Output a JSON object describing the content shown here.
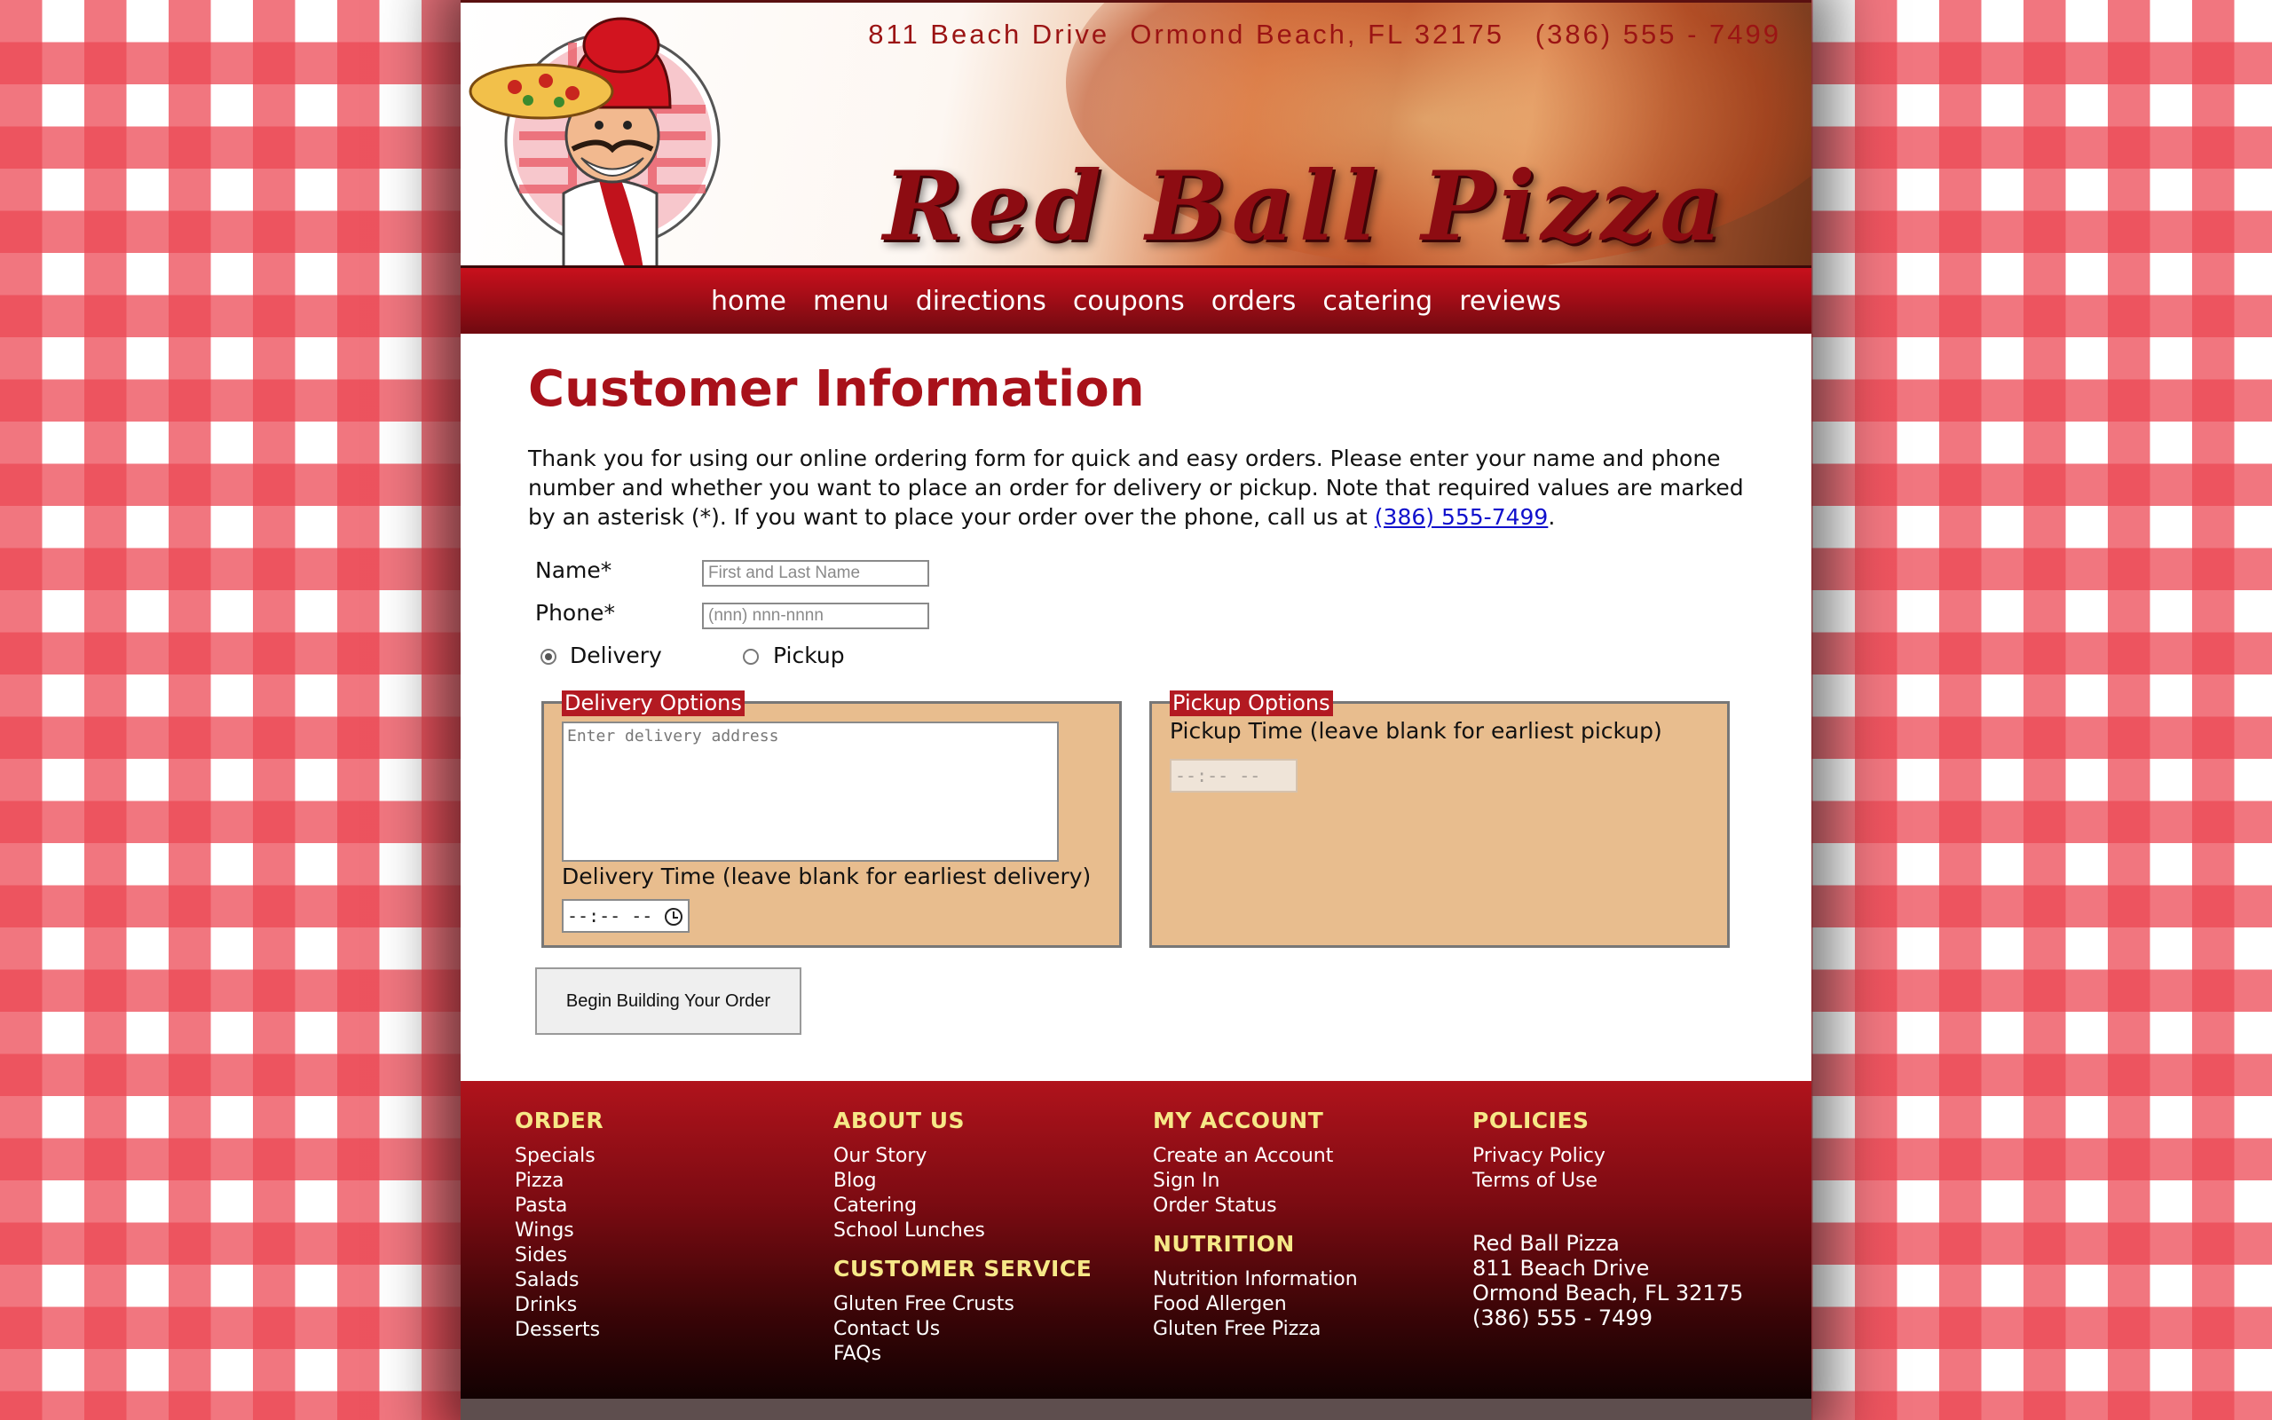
{
  "header": {
    "contact_line": "811 Beach Drive  Ormond Beach, FL 32175   (386) 555 - 7499",
    "site_title": "Red Ball Pizza",
    "mascot_icon": "chef-mascot-icon"
  },
  "nav": {
    "items": [
      "home",
      "menu",
      "directions",
      "coupons",
      "orders",
      "catering",
      "reviews"
    ]
  },
  "main": {
    "title": "Customer Information",
    "intro_text": "Thank you for using our online ordering form for quick and easy orders. Please enter your name and phone number and whether you want to place an order for delivery or pickup. Note that required values are marked by an asterisk (*). If you want to place your order over the phone, call us at ",
    "intro_phone": "(386) 555-7499",
    "intro_end": ".",
    "form": {
      "name_label": "Name*",
      "name_placeholder": "First and Last Name",
      "phone_label": "Phone*",
      "phone_placeholder": "(nnn) nnn-nnnn",
      "delivery_label": "Delivery",
      "pickup_label": "Pickup",
      "selected_option": "Delivery",
      "delivery_legend": "Delivery Options",
      "address_placeholder": "Enter delivery address",
      "delivery_time_label": "Delivery Time (leave blank for earliest delivery)",
      "delivery_time_value": "--:-- --",
      "pickup_legend": "Pickup Options",
      "pickup_time_label": "Pickup Time (leave blank for earliest pickup)",
      "pickup_time_value": "--:-- --",
      "submit_label": "Begin Building Your Order"
    }
  },
  "footer": {
    "order": {
      "heading": "ORDER",
      "links": [
        "Specials",
        "Pizza",
        "Pasta",
        "Wings",
        "Sides",
        "Salads",
        "Drinks",
        "Desserts"
      ]
    },
    "about": {
      "heading": "ABOUT US",
      "links": [
        "Our Story",
        "Blog",
        "Catering",
        "School Lunches"
      ]
    },
    "service": {
      "heading": "CUSTOMER SERVICE",
      "links": [
        "Gluten Free Crusts",
        "Contact Us",
        "FAQs"
      ]
    },
    "account": {
      "heading": "MY ACCOUNT",
      "links": [
        "Create an Account",
        "Sign In",
        "Order Status"
      ]
    },
    "nutrition": {
      "heading": "NUTRITION",
      "links": [
        "Nutrition Information",
        "Food Allergen",
        "Gluten Free Pizza"
      ]
    },
    "policies": {
      "heading": "POLICIES",
      "links": [
        "Privacy Policy",
        "Terms of Use"
      ]
    },
    "address": [
      "Red Ball Pizza",
      "811 Beach Drive",
      "Ormond Beach, FL 32175",
      "(386) 555 - 7499"
    ]
  },
  "colors": {
    "brand_red": "#a8111a",
    "footer_heading": "#f6e887",
    "fieldset_bg": "#e8bd8e"
  }
}
